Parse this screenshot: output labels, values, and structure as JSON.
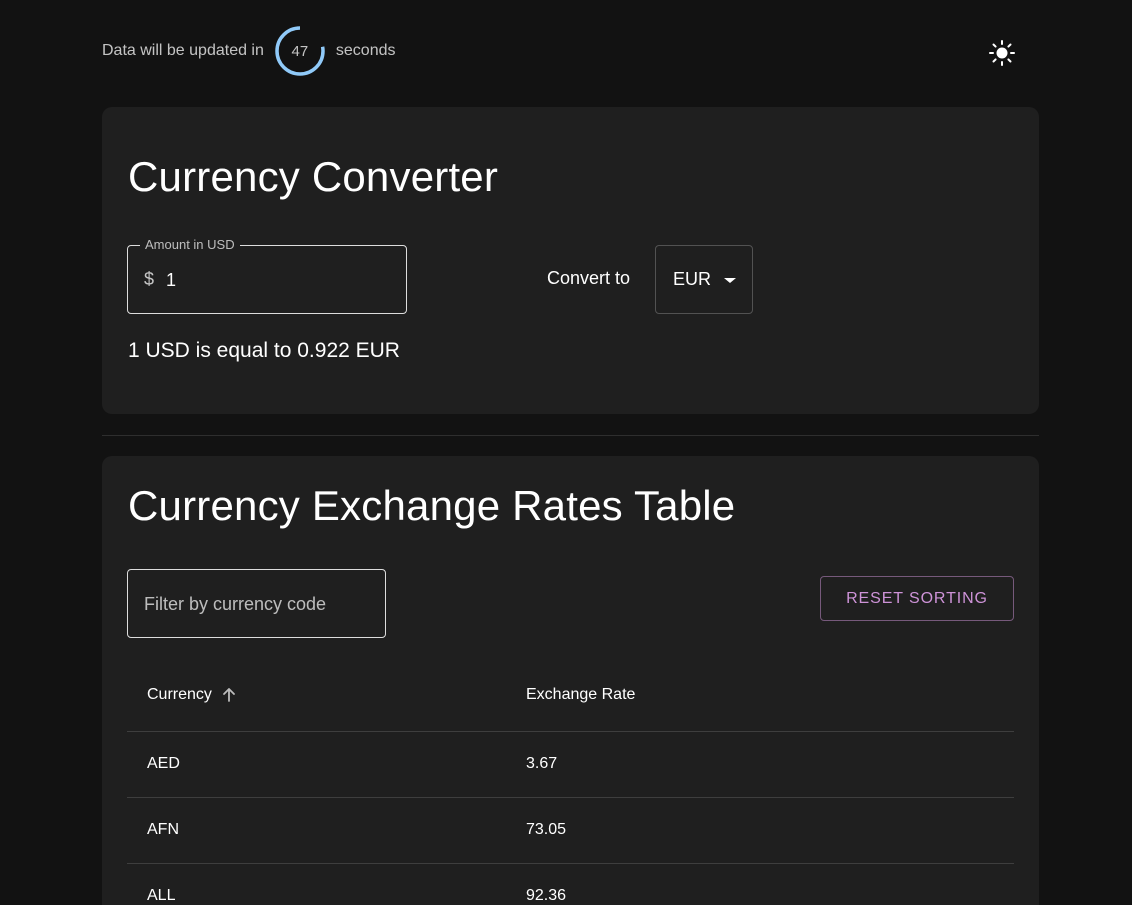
{
  "header": {
    "update_prefix": "Data will be updated in",
    "countdown_value": "47",
    "countdown_fraction": 0.78,
    "update_suffix": "seconds",
    "theme_icon": "sun-icon"
  },
  "converter": {
    "title": "Currency Converter",
    "amount_label": "Amount in USD",
    "amount_prefix": "$",
    "amount_value": "1",
    "convert_to_label": "Convert to",
    "selected_currency": "EUR",
    "result": "1 USD is equal to 0.922 EUR"
  },
  "rates": {
    "title": "Currency Exchange Rates Table",
    "filter_placeholder": "Filter by currency code",
    "reset_button": "RESET SORTING",
    "columns": [
      "Currency",
      "Exchange Rate"
    ],
    "sort_icon": "arrow-up-icon",
    "rows": [
      {
        "code": "AED",
        "rate": "3.67"
      },
      {
        "code": "AFN",
        "rate": "73.05"
      },
      {
        "code": "ALL",
        "rate": "92.36"
      }
    ]
  },
  "colors": {
    "background": "#121212",
    "card": "#1f1f1f",
    "accent": "#ce93d8",
    "countdown_ring": "#90caf9"
  }
}
